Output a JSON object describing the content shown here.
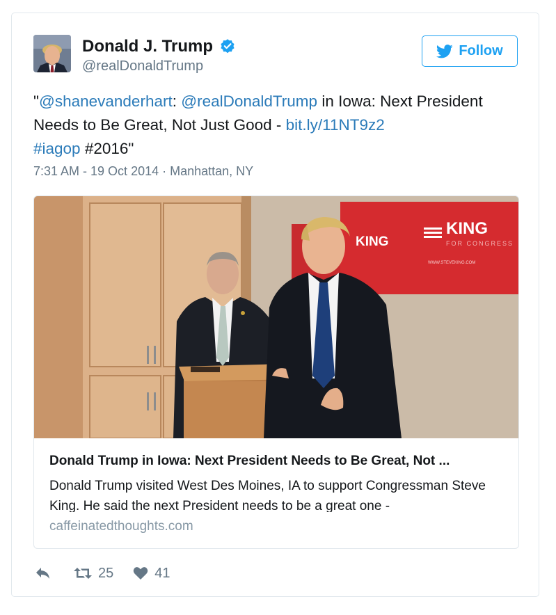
{
  "user": {
    "name": "Donald J. Trump",
    "handle": "@realDonaldTrump"
  },
  "follow_label": "Follow",
  "tweet": {
    "open_quote": "\"",
    "mention1": "@shanevanderhart",
    "colon": ": ",
    "mention2": "@realDonaldTrump",
    "text1": " in Iowa: Next President Needs to Be Great, Not Just Good - ",
    "link": "bit.ly/11NT9z2",
    "space": " ",
    "hashtag": "#iagop",
    "text2": " #2016\""
  },
  "meta": "7:31 AM - 19 Oct 2014 · Manhattan, NY",
  "card": {
    "title": "Donald Trump in Iowa: Next President Needs to Be Great, Not ...",
    "description": "Donald Trump visited West Des Moines, IA to support Congressman Steve King. He said the next President needs to be a great one - ",
    "domain": "caffeinatedthoughts.com",
    "banner_text_left": "KING",
    "banner_text_right": "KING",
    "banner_sub": "FOR CONGRESS",
    "banner_url": "WWW.STEVEKING.COM"
  },
  "actions": {
    "retweets": "25",
    "likes": "41"
  },
  "colors": {
    "accent": "#1da1f2",
    "link": "#2b7bb9",
    "banner_red": "#d52b2f"
  }
}
